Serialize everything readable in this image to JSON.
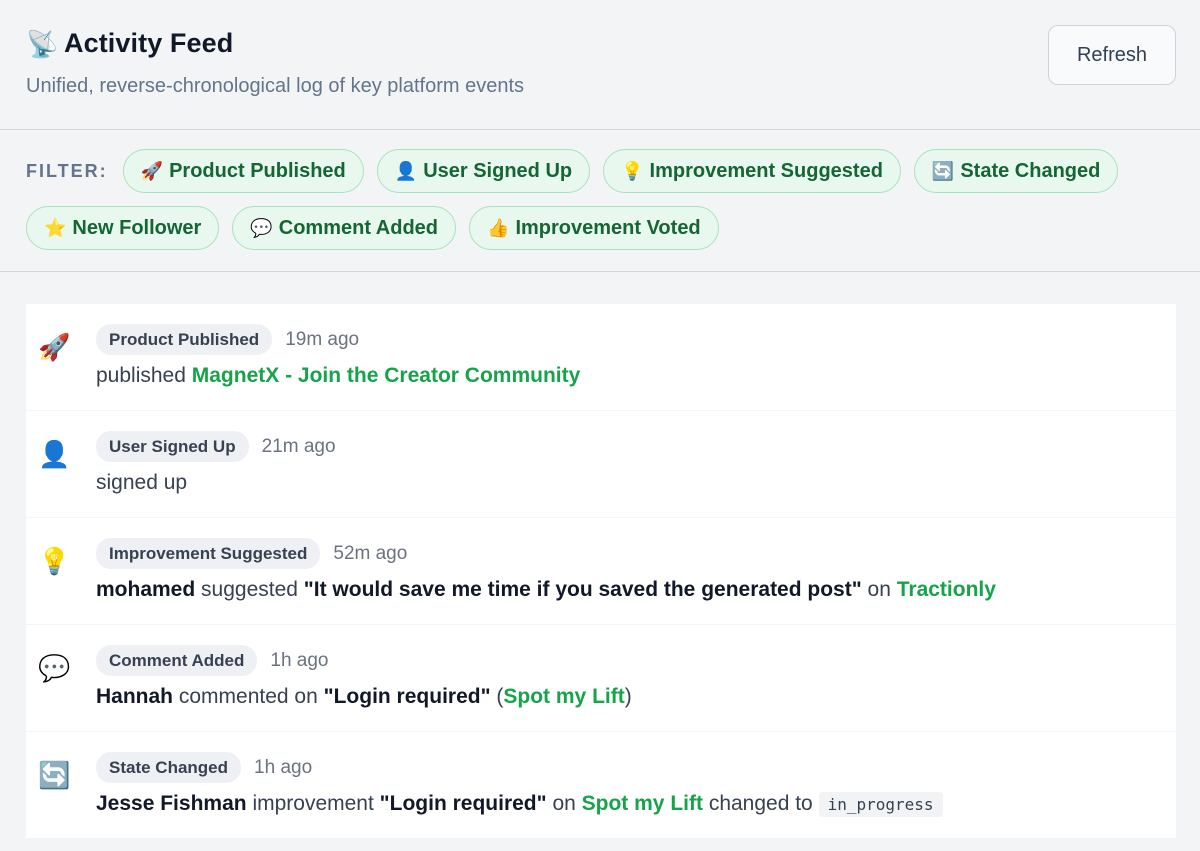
{
  "header": {
    "icon": "📡",
    "title": "Activity Feed",
    "subtitle": "Unified, reverse-chronological log of key platform events",
    "refresh_label": "Refresh"
  },
  "filters": {
    "label": "FILTER:",
    "chips": [
      {
        "icon": "🚀",
        "label": "Product Published"
      },
      {
        "icon": "👤",
        "label": "User Signed Up"
      },
      {
        "icon": "💡",
        "label": "Improvement Suggested"
      },
      {
        "icon": "🔄",
        "label": "State Changed"
      },
      {
        "icon": "⭐",
        "label": "New Follower"
      },
      {
        "icon": "💬",
        "label": "Comment Added"
      },
      {
        "icon": "👍",
        "label": "Improvement Voted"
      }
    ]
  },
  "feed": [
    {
      "icon": "🚀",
      "type": "Product Published",
      "time": "19m ago",
      "text": {
        "verb": "published",
        "link": "MagnetX - Join the Creator Community"
      }
    },
    {
      "icon": "👤",
      "type": "User Signed Up",
      "time": "21m ago",
      "text": {
        "verb": "signed up"
      }
    },
    {
      "icon": "💡",
      "type": "Improvement Suggested",
      "time": "52m ago",
      "text": {
        "user": "mohamed",
        "verb": "suggested",
        "quote": "\"It would save me time if you saved the generated post\"",
        "on": "on",
        "link": "Tractionly"
      }
    },
    {
      "icon": "💬",
      "type": "Comment Added",
      "time": "1h ago",
      "text": {
        "user": "Hannah",
        "verb": "commented on",
        "quote": "\"Login required\"",
        "open": "(",
        "link": "Spot my Lift",
        "close": ")"
      }
    },
    {
      "icon": "🔄",
      "type": "State Changed",
      "time": "1h ago",
      "text": {
        "user": "Jesse Fishman",
        "verb": "improvement",
        "quote": "\"Login required\"",
        "on": "on",
        "link": "Spot my Lift",
        "changed": "changed to",
        "state": "in_progress"
      }
    }
  ]
}
